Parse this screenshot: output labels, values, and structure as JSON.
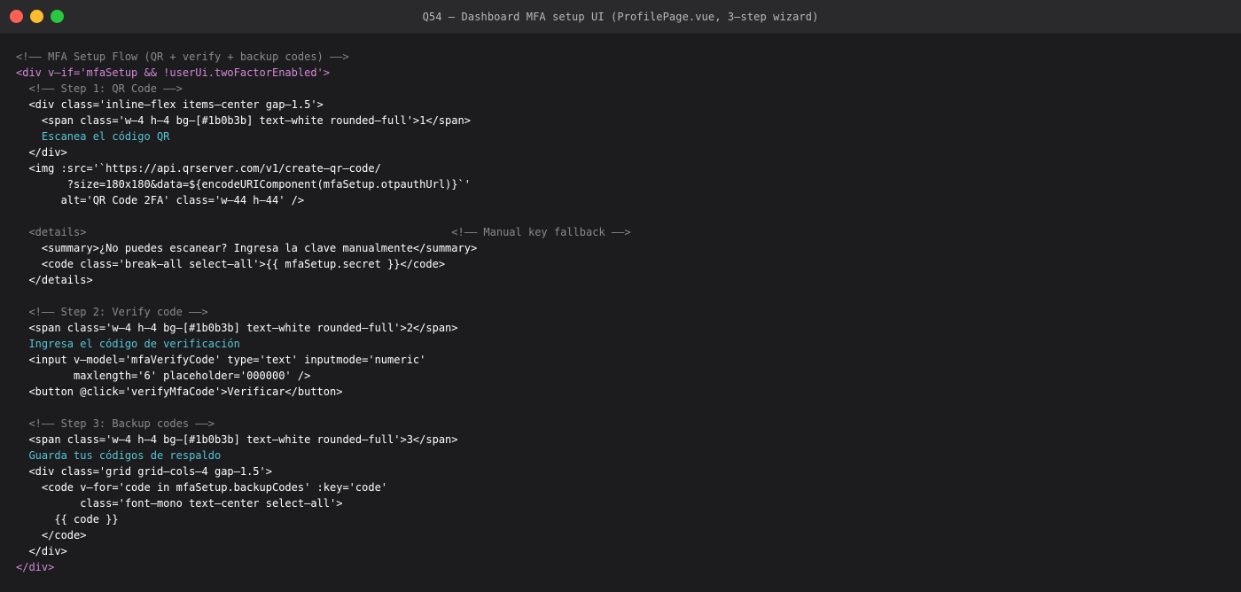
{
  "window": {
    "title": "Q54 — Dashboard MFA setup UI (ProfilePage.vue, 3—step wizard)"
  },
  "code": {
    "lines": [
      {
        "text": "<!—— MFA Setup Flow (QR + verify + backup codes) ——>",
        "kind": "comment"
      },
      {
        "text": "<div v—if='mfaSetup && !userUi.twoFactorEnabled'>",
        "kind": "dir"
      },
      {
        "text": "  <!—— Step 1: QR Code ——>",
        "kind": "comment"
      },
      {
        "text": "  <div class='inline—flex items—center gap—1.5'>",
        "kind": "tag"
      },
      {
        "text": "    <span class='w—4 h—4 bg—[#1b0b3b] text—white rounded—full'>1</span>",
        "kind": "tag"
      },
      {
        "text": "    Escanea el código QR",
        "kind": "text"
      },
      {
        "text": "  </div>",
        "kind": "tag"
      },
      {
        "text": "  <img :src='`https://api.qrserver.com/v1/create—qr—code/",
        "kind": "tag"
      },
      {
        "text": "        ?size=180x180&data=${encodeURIComponent(mfaSetup.otpauthUrl)}`'",
        "kind": "tag"
      },
      {
        "text": "       alt='QR Code 2FA' class='w—44 h—44' />",
        "kind": "tag"
      },
      {
        "text": "",
        "kind": "tag"
      },
      {
        "text": "  <details>                                                         <!—— Manual key fallback ——>",
        "kind": "comment"
      },
      {
        "text": "    <summary>¿No puedes escanear? Ingresa la clave manualmente</summary>",
        "kind": "tag"
      },
      {
        "text": "    <code class='break—all select—all'>{{ mfaSetup.secret }}</code>",
        "kind": "tag"
      },
      {
        "text": "  </details>",
        "kind": "tag"
      },
      {
        "text": "",
        "kind": "tag"
      },
      {
        "text": "  <!—— Step 2: Verify code ——>",
        "kind": "comment"
      },
      {
        "text": "  <span class='w—4 h—4 bg—[#1b0b3b] text—white rounded—full'>2</span>",
        "kind": "tag"
      },
      {
        "text": "  Ingresa el código de verificación",
        "kind": "text"
      },
      {
        "text": "  <input v—model='mfaVerifyCode' type='text' inputmode='numeric'",
        "kind": "tag"
      },
      {
        "text": "         maxlength='6' placeholder='000000' />",
        "kind": "tag"
      },
      {
        "text": "  <button @click='verifyMfaCode'>Verificar</button>",
        "kind": "tag"
      },
      {
        "text": "",
        "kind": "tag"
      },
      {
        "text": "  <!—— Step 3: Backup codes ——>",
        "kind": "comment"
      },
      {
        "text": "  <span class='w—4 h—4 bg—[#1b0b3b] text—white rounded—full'>3</span>",
        "kind": "tag"
      },
      {
        "text": "  Guarda tus códigos de respaldo",
        "kind": "text"
      },
      {
        "text": "  <div class='grid grid—cols—4 gap—1.5'>",
        "kind": "tag"
      },
      {
        "text": "    <code v—for='code in mfaSetup.backupCodes' :key='code'",
        "kind": "tag"
      },
      {
        "text": "          class='font—mono text—center select—all'>",
        "kind": "tag"
      },
      {
        "text": "      {{ code }}",
        "kind": "tag"
      },
      {
        "text": "    </code>",
        "kind": "tag"
      },
      {
        "text": "  </div>",
        "kind": "tag"
      },
      {
        "text": "</div>",
        "kind": "dir"
      }
    ]
  },
  "colors": {
    "background": "#1c1c1e",
    "titlebar": "#2a2a2c",
    "comment": "#8a8a8e",
    "tag": "#ffffff",
    "directive": "#d389d8",
    "text": "#56c6d6",
    "close": "#fe5f57",
    "minimize": "#febc2e",
    "maximize": "#28c840"
  }
}
